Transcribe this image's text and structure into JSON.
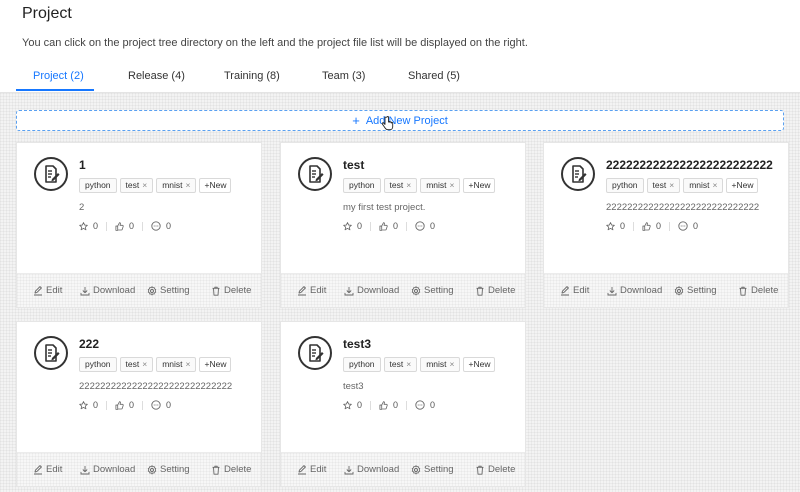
{
  "header": {
    "title": "Project",
    "description": "You can click on the project tree directory on the left and the project file list will be displayed on the right."
  },
  "tabs": [
    {
      "label": "Project (2)",
      "active": true
    },
    {
      "label": "Release (4)",
      "active": false
    },
    {
      "label": "Training (8)",
      "active": false
    },
    {
      "label": "Team (3)",
      "active": false
    },
    {
      "label": "Shared (5)",
      "active": false
    }
  ],
  "add_button": {
    "label": "Add New Project",
    "icon": "plus-icon"
  },
  "accent_color": "#1677ff",
  "projects": [
    {
      "title": "1",
      "tags": [
        {
          "label": "python",
          "closable": false
        },
        {
          "label": "test",
          "closable": true
        },
        {
          "label": "mnist",
          "closable": true
        }
      ],
      "new_tag": "+New",
      "description": "2",
      "stars": "0",
      "likes": "0",
      "comments": "0",
      "actions": {
        "edit": "Edit",
        "download": "Download",
        "setting": "Setting",
        "delete": "Delete"
      }
    },
    {
      "title": "test",
      "tags": [
        {
          "label": "python",
          "closable": false
        },
        {
          "label": "test",
          "closable": true
        },
        {
          "label": "mnist",
          "closable": true
        }
      ],
      "new_tag": "+New",
      "description": "my first test project.",
      "stars": "0",
      "likes": "0",
      "comments": "0",
      "actions": {
        "edit": "Edit",
        "download": "Download",
        "setting": "Setting",
        "delete": "Delete"
      }
    },
    {
      "title": "2222222222222222222222222",
      "tags": [
        {
          "label": "python",
          "closable": false
        },
        {
          "label": "test",
          "closable": true
        },
        {
          "label": "mnist",
          "closable": true
        }
      ],
      "new_tag": "+New",
      "description": "22222222222222222222222222222",
      "stars": "0",
      "likes": "0",
      "comments": "0",
      "actions": {
        "edit": "Edit",
        "download": "Download",
        "setting": "Setting",
        "delete": "Delete"
      }
    },
    {
      "title": "222",
      "tags": [
        {
          "label": "python",
          "closable": false
        },
        {
          "label": "test",
          "closable": true
        },
        {
          "label": "mnist",
          "closable": true
        }
      ],
      "new_tag": "+New",
      "description": "22222222222222222222222222222",
      "stars": "0",
      "likes": "0",
      "comments": "0",
      "actions": {
        "edit": "Edit",
        "download": "Download",
        "setting": "Setting",
        "delete": "Delete"
      }
    },
    {
      "title": "test3",
      "tags": [
        {
          "label": "python",
          "closable": false
        },
        {
          "label": "test",
          "closable": true
        },
        {
          "label": "mnist",
          "closable": true
        }
      ],
      "new_tag": "+New",
      "description": "test3",
      "stars": "0",
      "likes": "0",
      "comments": "0",
      "actions": {
        "edit": "Edit",
        "download": "Download",
        "setting": "Setting",
        "delete": "Delete"
      }
    }
  ]
}
